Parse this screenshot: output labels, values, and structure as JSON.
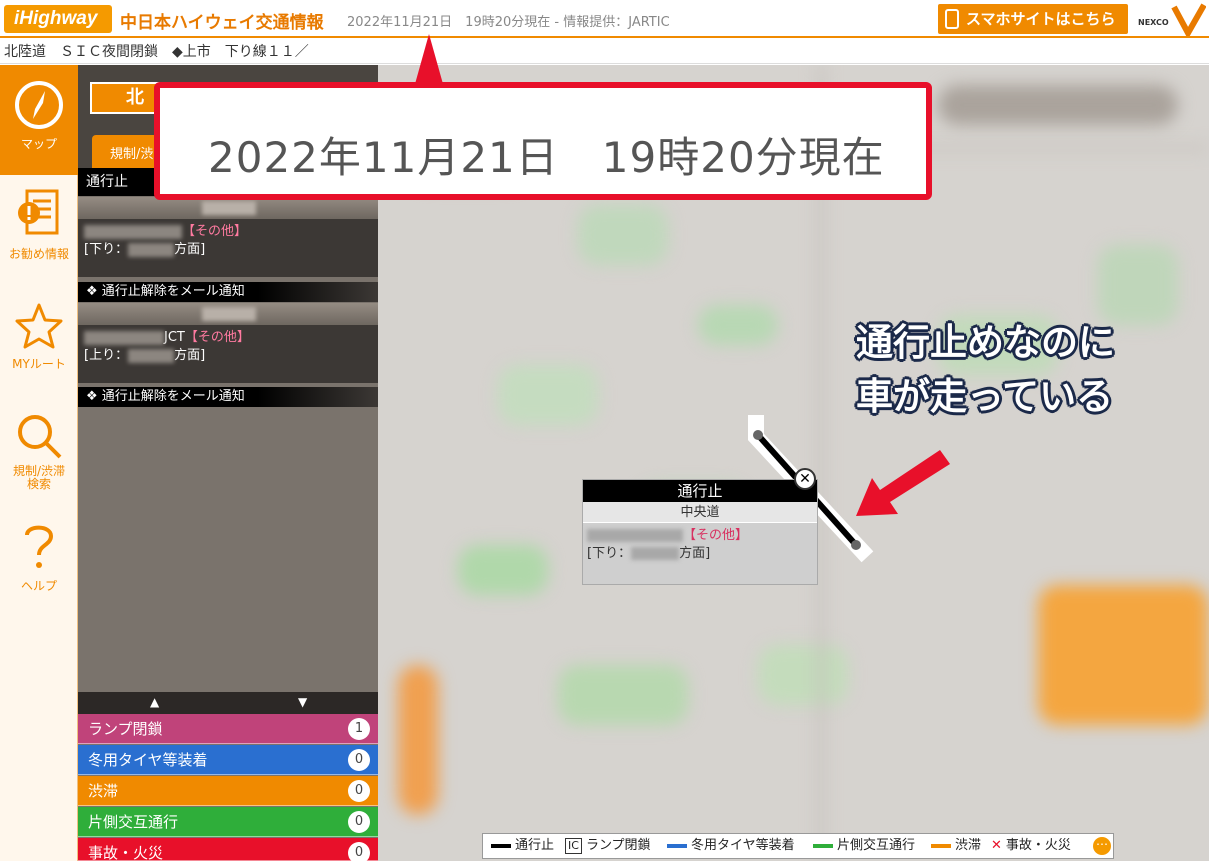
{
  "header": {
    "logo_text": "Highway",
    "site_title": "中日本ハイウェイ交通情報",
    "timestamp": "2022年11月21日　19時20分現在 - 情報提供：JARTIC",
    "smartphone_button": "スマホサイトはこちら",
    "brand": "NEXCO"
  },
  "ticker": {
    "text": "北陸道　ＳＩＣ夜間閉鎖　◆上市　下り線１１／"
  },
  "nav": {
    "items": [
      {
        "label": "マップ",
        "icon": "compass-icon",
        "active": true
      },
      {
        "label": "お勧め情報",
        "icon": "info-doc-icon"
      },
      {
        "label": "MYルート",
        "icon": "star-icon"
      },
      {
        "label": "規制/渋滞\n検索",
        "icon": "search-icon"
      },
      {
        "label": "ヘルプ",
        "icon": "question-icon"
      }
    ]
  },
  "panel": {
    "region_label": "北",
    "tab_label": "規制/渋",
    "list_header": "通行止",
    "entries": [
      {
        "tag": "【その他】",
        "direction_prefix": "[下り：",
        "direction_suffix": "方面]"
      },
      {
        "suffix": "JCT",
        "tag": "【その他】",
        "direction_prefix": "[上り：",
        "direction_suffix": "方面]"
      }
    ],
    "notify_label": "❖ 通行止解除をメール通知",
    "scroll_up": "▲",
    "scroll_down": "▼"
  },
  "categories": [
    {
      "label": "ランプ閉鎖",
      "count": "1",
      "color": "#c0437a"
    },
    {
      "label": "冬用タイヤ等装着",
      "count": "0",
      "color": "#2a6fd0"
    },
    {
      "label": "渋滞",
      "count": "0",
      "color": "#f08a00"
    },
    {
      "label": "片側交互通行",
      "count": "0",
      "color": "#2fae3a"
    },
    {
      "label": "事故・火災",
      "count": "0",
      "color": "#e8102a"
    }
  ],
  "callout": {
    "text": "2022年11月21日　19時20分現在"
  },
  "annotation": {
    "line1": "通行止めなのに",
    "line2": "車が走っている"
  },
  "popup": {
    "title": "通行止",
    "road": "中央道",
    "tag": "【その他】",
    "direction_prefix": "[下り：",
    "direction_suffix": "方面]",
    "close": "✕"
  },
  "legend": {
    "closed": "通行止",
    "ramp_icon": "IC",
    "ramp": "ランプ閉鎖",
    "winter": "冬用タイヤ等装着",
    "alternating": "片側交互通行",
    "jam": "渋滞",
    "accident": "事故・火災",
    "more": "⋯"
  }
}
